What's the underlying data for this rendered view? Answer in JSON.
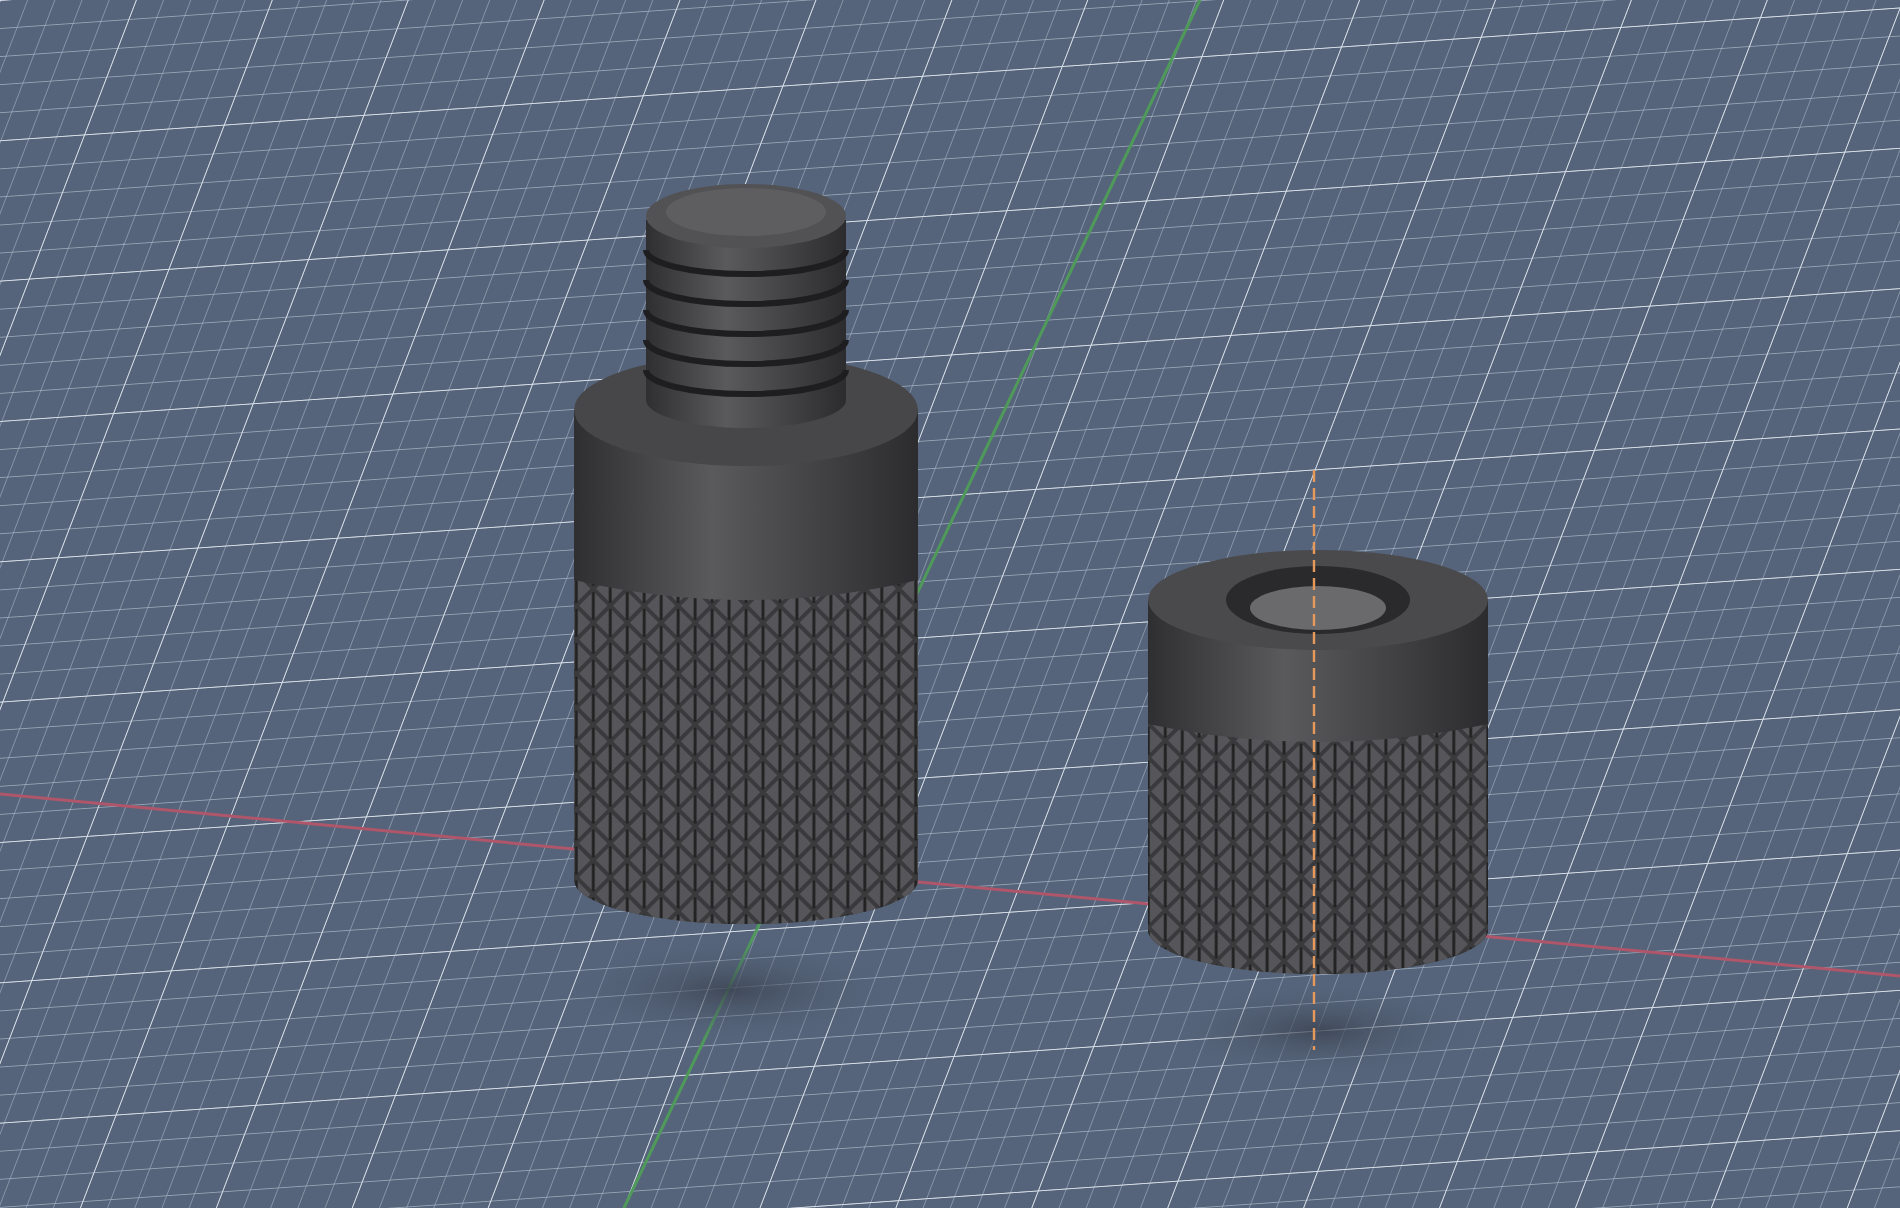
{
  "viewport": {
    "objects": [
      {
        "kind": "threaded-adapter"
      },
      {
        "kind": "knurled-nut"
      }
    ]
  }
}
